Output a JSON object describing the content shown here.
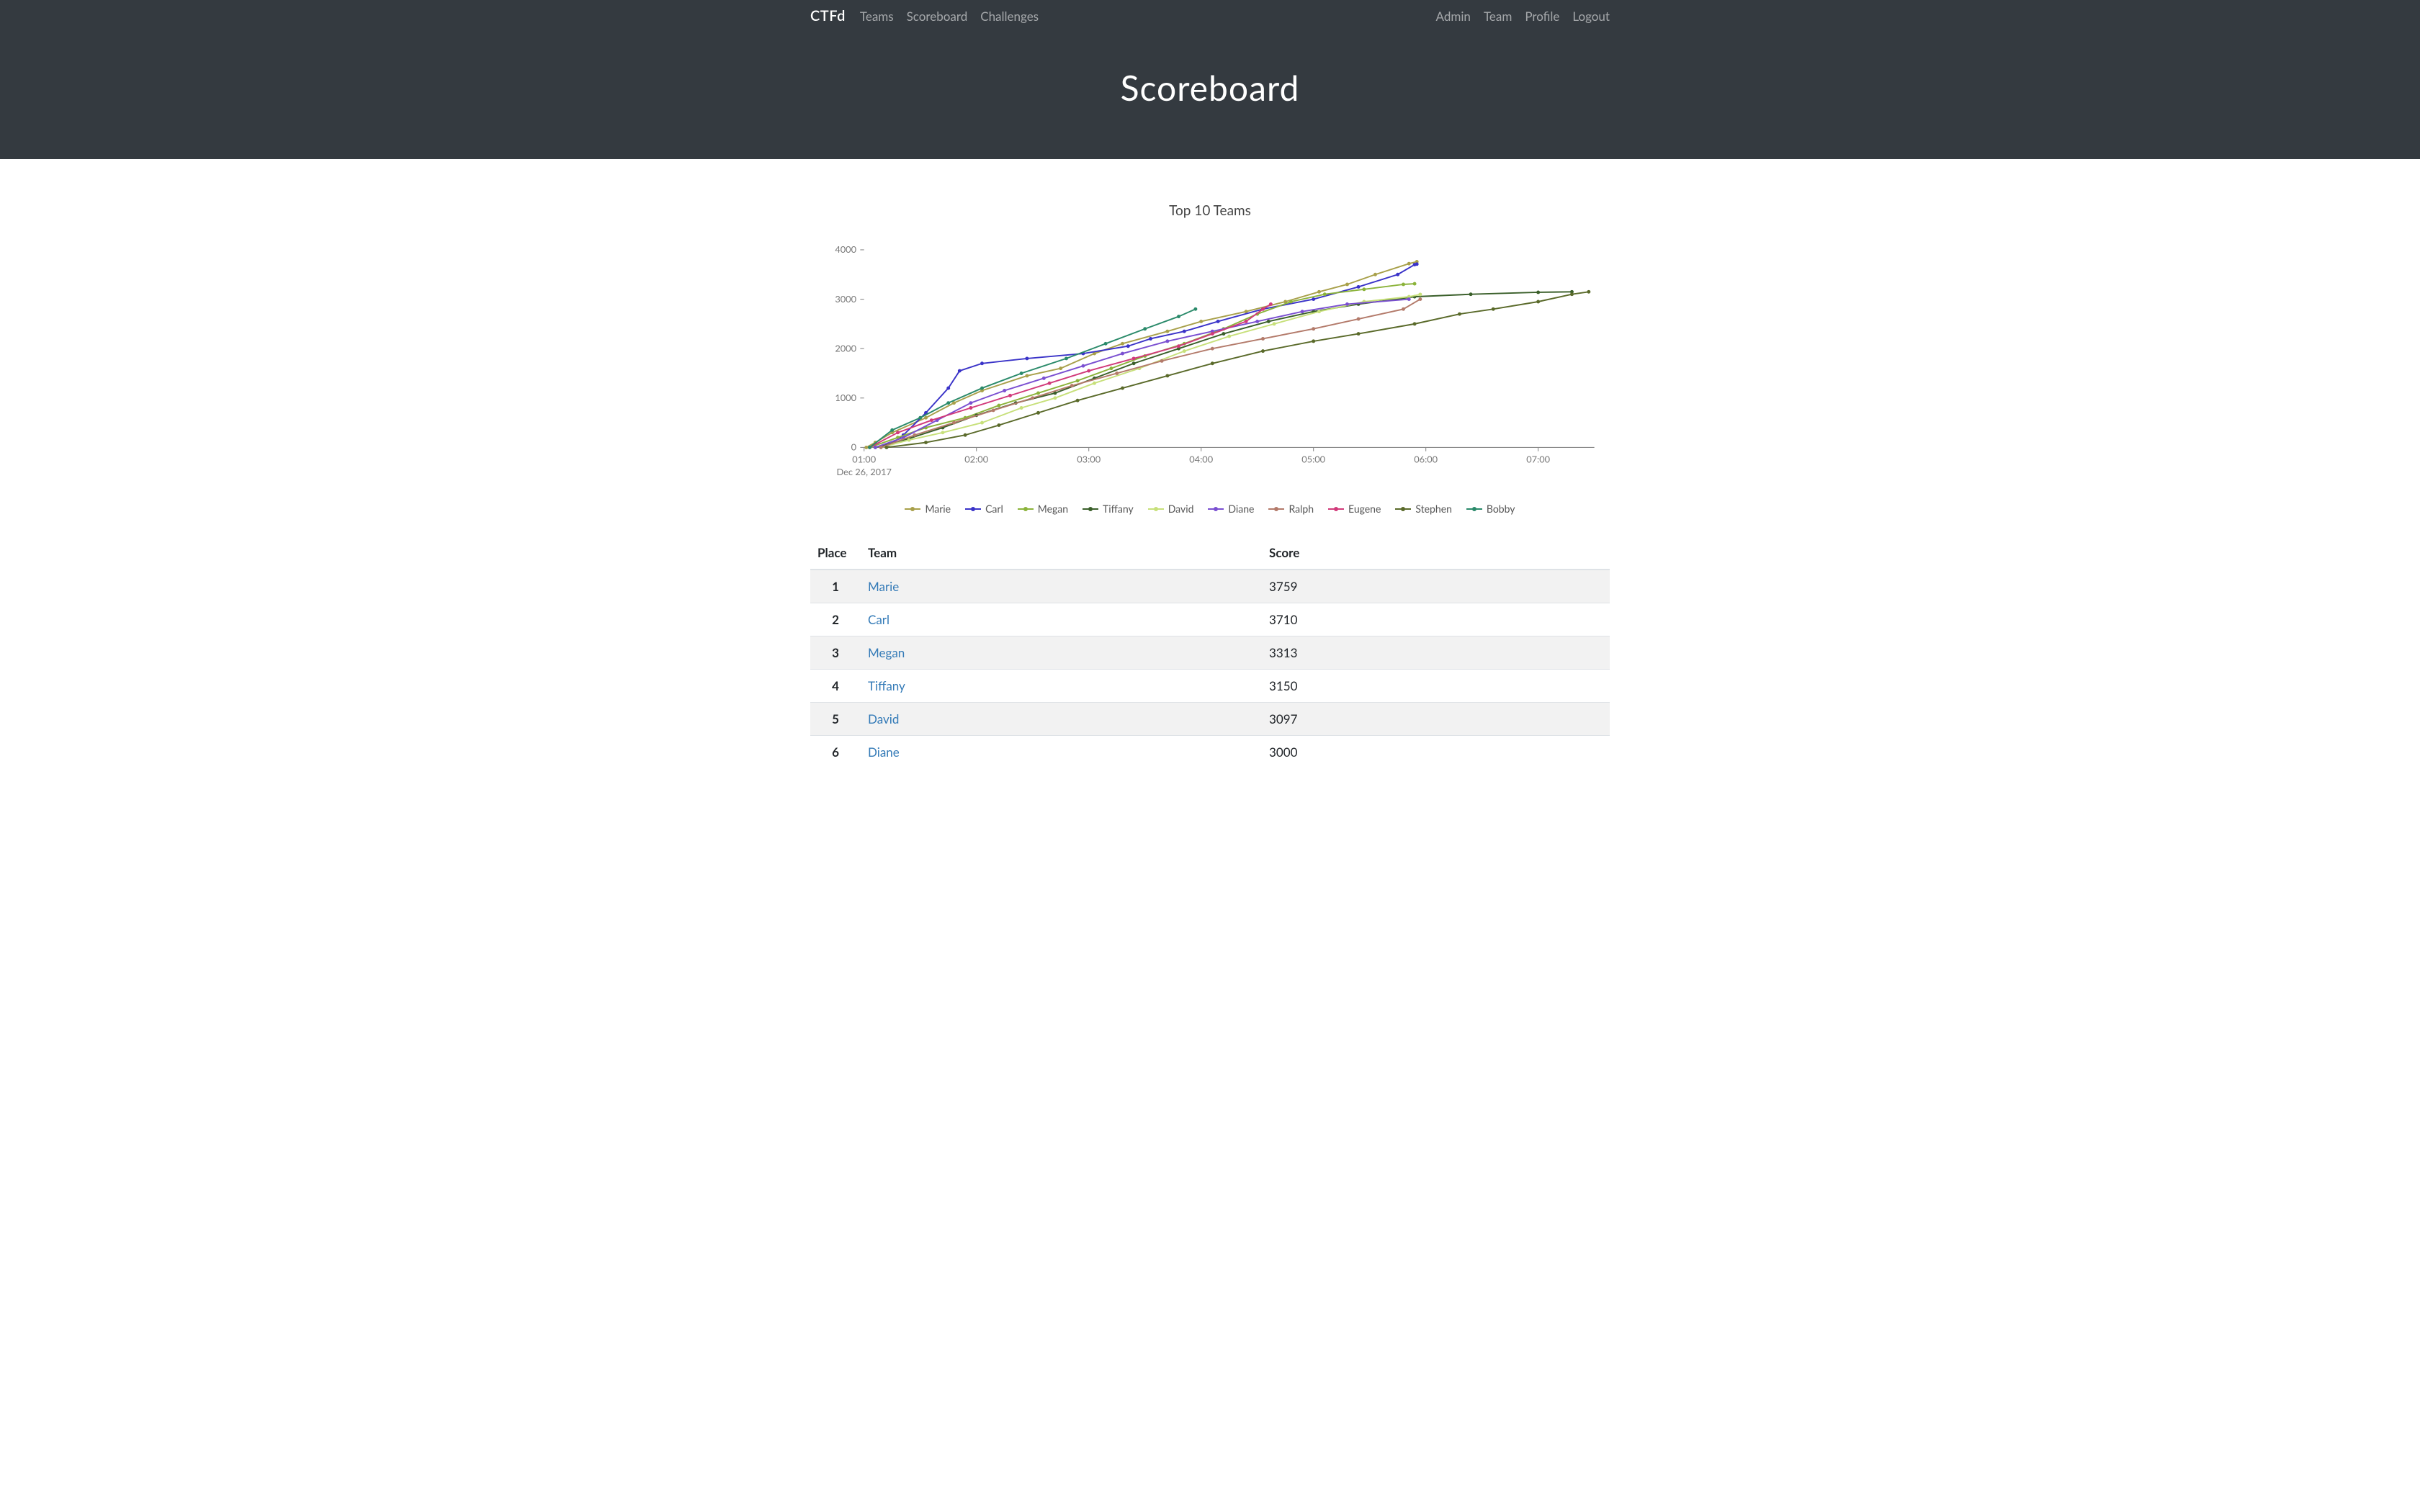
{
  "nav": {
    "brand": "CTFd",
    "left": [
      "Teams",
      "Scoreboard",
      "Challenges"
    ],
    "right": [
      "Admin",
      "Team",
      "Profile",
      "Logout"
    ]
  },
  "page_title": "Scoreboard",
  "table": {
    "headers": {
      "place": "Place",
      "team": "Team",
      "score": "Score"
    },
    "rows": [
      {
        "place": "1",
        "team": "Marie",
        "score": "3759"
      },
      {
        "place": "2",
        "team": "Carl",
        "score": "3710"
      },
      {
        "place": "3",
        "team": "Megan",
        "score": "3313"
      },
      {
        "place": "4",
        "team": "Tiffany",
        "score": "3150"
      },
      {
        "place": "5",
        "team": "David",
        "score": "3097"
      },
      {
        "place": "6",
        "team": "Diane",
        "score": "3000"
      }
    ]
  },
  "chart_data": {
    "type": "line",
    "title": "Top 10 Teams",
    "xlabel": "",
    "ylabel": "",
    "xlim": [
      1,
      7.5
    ],
    "ylim": [
      0,
      4200
    ],
    "y_ticks": [
      0,
      1000,
      2000,
      3000,
      4000
    ],
    "x_ticks": [
      "01:00",
      "02:00",
      "03:00",
      "04:00",
      "05:00",
      "06:00",
      "07:00"
    ],
    "x_date_label": "Dec 26, 2017",
    "colors": {
      "Marie": "#a8a04a",
      "Carl": "#3a33c8",
      "Megan": "#8bb33a",
      "Tiffany": "#3a5f2a",
      "David": "#c7e07a",
      "Diane": "#7a4fd1",
      "Ralph": "#b37a6a",
      "Eugene": "#d13a7a",
      "Stephen": "#5a6a2a",
      "Bobby": "#2a8a6a"
    },
    "series": [
      {
        "name": "Marie",
        "points": [
          [
            1.02,
            0
          ],
          [
            1.1,
            100
          ],
          [
            1.25,
            300
          ],
          [
            1.55,
            600
          ],
          [
            1.8,
            900
          ],
          [
            2.05,
            1150
          ],
          [
            2.45,
            1450
          ],
          [
            2.75,
            1600
          ],
          [
            3.05,
            1900
          ],
          [
            3.3,
            2100
          ],
          [
            3.7,
            2350
          ],
          [
            4.0,
            2550
          ],
          [
            4.4,
            2750
          ],
          [
            4.75,
            2950
          ],
          [
            5.05,
            3150
          ],
          [
            5.3,
            3300
          ],
          [
            5.55,
            3500
          ],
          [
            5.85,
            3720
          ],
          [
            5.92,
            3759
          ]
        ]
      },
      {
        "name": "Carl",
        "points": [
          [
            1.2,
            0
          ],
          [
            1.35,
            250
          ],
          [
            1.55,
            700
          ],
          [
            1.75,
            1200
          ],
          [
            1.85,
            1550
          ],
          [
            2.05,
            1700
          ],
          [
            2.45,
            1800
          ],
          [
            2.95,
            1900
          ],
          [
            3.35,
            2050
          ],
          [
            3.55,
            2200
          ],
          [
            3.85,
            2350
          ],
          [
            4.15,
            2550
          ],
          [
            4.55,
            2800
          ],
          [
            5.0,
            3000
          ],
          [
            5.4,
            3250
          ],
          [
            5.75,
            3500
          ],
          [
            5.9,
            3700
          ],
          [
            5.92,
            3710
          ]
        ]
      },
      {
        "name": "Megan",
        "points": [
          [
            1.05,
            0
          ],
          [
            1.3,
            200
          ],
          [
            1.55,
            400
          ],
          [
            1.9,
            600
          ],
          [
            2.2,
            850
          ],
          [
            2.55,
            1100
          ],
          [
            2.9,
            1350
          ],
          [
            3.2,
            1600
          ],
          [
            3.5,
            1850
          ],
          [
            3.85,
            2100
          ],
          [
            4.2,
            2400
          ],
          [
            4.5,
            2700
          ],
          [
            4.8,
            2950
          ],
          [
            5.1,
            3100
          ],
          [
            5.45,
            3200
          ],
          [
            5.8,
            3300
          ],
          [
            5.9,
            3313
          ]
        ]
      },
      {
        "name": "Tiffany",
        "points": [
          [
            1.1,
            0
          ],
          [
            1.4,
            180
          ],
          [
            1.7,
            400
          ],
          [
            2.0,
            650
          ],
          [
            2.35,
            900
          ],
          [
            2.7,
            1100
          ],
          [
            3.05,
            1400
          ],
          [
            3.4,
            1700
          ],
          [
            3.8,
            2000
          ],
          [
            4.2,
            2300
          ],
          [
            4.6,
            2550
          ],
          [
            5.0,
            2750
          ],
          [
            5.4,
            2900
          ],
          [
            5.9,
            3050
          ],
          [
            6.4,
            3100
          ],
          [
            7.0,
            3140
          ],
          [
            7.3,
            3150
          ]
        ]
      },
      {
        "name": "David",
        "points": [
          [
            1.15,
            0
          ],
          [
            1.4,
            150
          ],
          [
            1.7,
            300
          ],
          [
            2.05,
            500
          ],
          [
            2.4,
            800
          ],
          [
            2.7,
            1000
          ],
          [
            3.05,
            1300
          ],
          [
            3.45,
            1600
          ],
          [
            3.85,
            1950
          ],
          [
            4.25,
            2250
          ],
          [
            4.65,
            2500
          ],
          [
            5.05,
            2750
          ],
          [
            5.45,
            2950
          ],
          [
            5.85,
            3050
          ],
          [
            5.95,
            3097
          ]
        ]
      },
      {
        "name": "Diane",
        "points": [
          [
            1.1,
            0
          ],
          [
            1.35,
            200
          ],
          [
            1.65,
            550
          ],
          [
            1.95,
            900
          ],
          [
            2.25,
            1150
          ],
          [
            2.6,
            1400
          ],
          [
            2.95,
            1650
          ],
          [
            3.3,
            1900
          ],
          [
            3.7,
            2150
          ],
          [
            4.1,
            2350
          ],
          [
            4.5,
            2550
          ],
          [
            4.9,
            2750
          ],
          [
            5.3,
            2900
          ],
          [
            5.85,
            3000
          ]
        ]
      },
      {
        "name": "Ralph",
        "points": [
          [
            1.15,
            0
          ],
          [
            1.45,
            250
          ],
          [
            1.8,
            500
          ],
          [
            2.15,
            750
          ],
          [
            2.5,
            1000
          ],
          [
            2.85,
            1250
          ],
          [
            3.25,
            1500
          ],
          [
            3.65,
            1750
          ],
          [
            4.1,
            2000
          ],
          [
            4.55,
            2200
          ],
          [
            5.0,
            2400
          ],
          [
            5.4,
            2600
          ],
          [
            5.8,
            2800
          ],
          [
            5.95,
            3000
          ]
        ]
      },
      {
        "name": "Eugene",
        "points": [
          [
            1.05,
            0
          ],
          [
            1.3,
            300
          ],
          [
            1.6,
            550
          ],
          [
            1.95,
            800
          ],
          [
            2.3,
            1050
          ],
          [
            2.65,
            1300
          ],
          [
            3.0,
            1550
          ],
          [
            3.4,
            1800
          ],
          [
            3.8,
            2050
          ],
          [
            4.1,
            2300
          ],
          [
            4.4,
            2550
          ],
          [
            4.55,
            2800
          ],
          [
            4.62,
            2900
          ]
        ]
      },
      {
        "name": "Stephen",
        "points": [
          [
            1.2,
            0
          ],
          [
            1.55,
            100
          ],
          [
            1.9,
            250
          ],
          [
            2.2,
            450
          ],
          [
            2.55,
            700
          ],
          [
            2.9,
            950
          ],
          [
            3.3,
            1200
          ],
          [
            3.7,
            1450
          ],
          [
            4.1,
            1700
          ],
          [
            4.55,
            1950
          ],
          [
            5.0,
            2150
          ],
          [
            5.4,
            2300
          ],
          [
            5.9,
            2500
          ],
          [
            6.3,
            2700
          ],
          [
            6.6,
            2800
          ],
          [
            7.0,
            2950
          ],
          [
            7.3,
            3100
          ],
          [
            7.45,
            3150
          ]
        ]
      },
      {
        "name": "Bobby",
        "points": [
          [
            1.05,
            0
          ],
          [
            1.25,
            350
          ],
          [
            1.5,
            600
          ],
          [
            1.75,
            900
          ],
          [
            2.05,
            1200
          ],
          [
            2.4,
            1500
          ],
          [
            2.8,
            1800
          ],
          [
            3.15,
            2100
          ],
          [
            3.5,
            2400
          ],
          [
            3.8,
            2650
          ],
          [
            3.95,
            2800
          ]
        ]
      }
    ]
  }
}
